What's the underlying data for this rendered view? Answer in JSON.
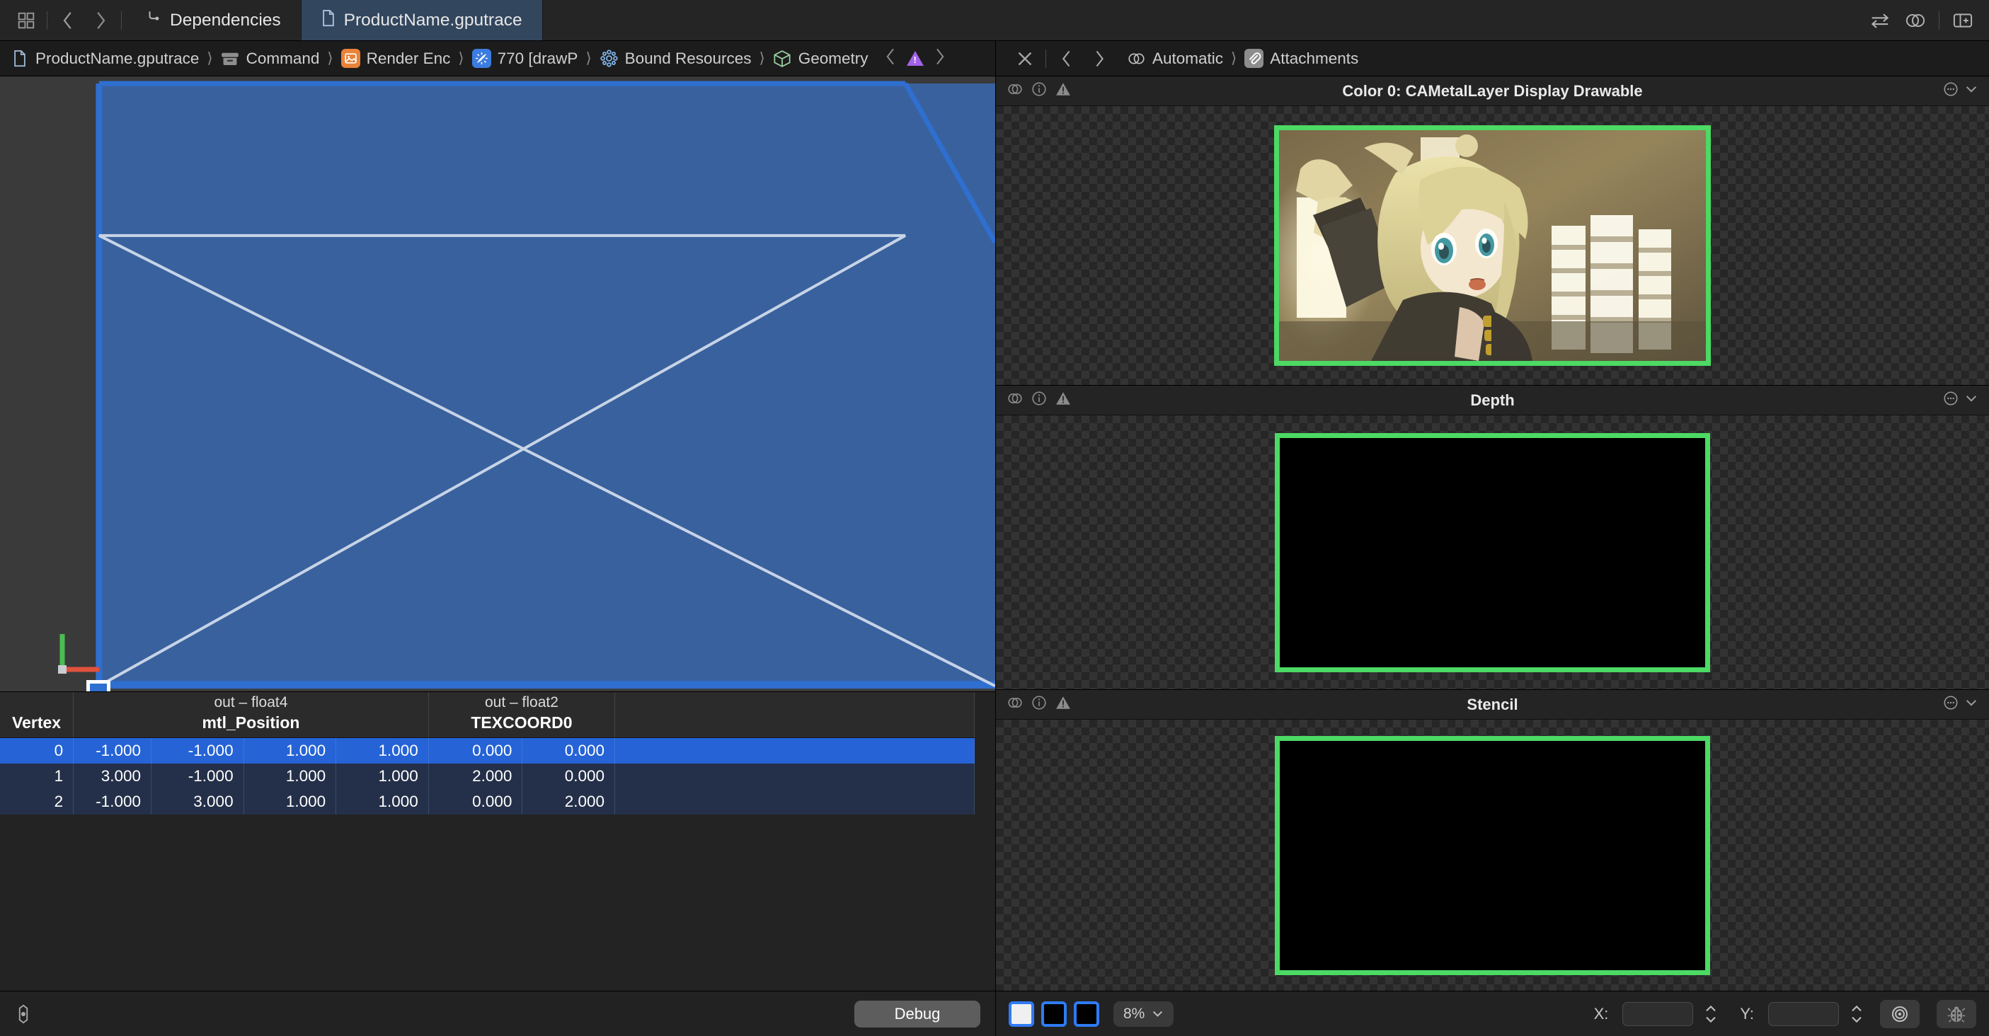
{
  "window": {
    "tabs": [
      {
        "label": "Dependencies",
        "icon": "dependencies-icon",
        "active": false
      },
      {
        "label": "ProductName.gputrace",
        "icon": "document-icon",
        "active": true
      }
    ],
    "toolbar_icons": [
      "grid-icon",
      "back-chevron-icon",
      "forward-chevron-icon"
    ],
    "right_icons": [
      "swap-arrows-icon",
      "overlap-circles-icon",
      "inspector-panel-icon"
    ]
  },
  "breadcrumb": {
    "items": [
      {
        "label": "ProductName.gputrace",
        "icon": "document-icon"
      },
      {
        "label": "Command",
        "icon": "archive-box-icon"
      },
      {
        "label": "Render Enc",
        "icon": "render-encoder-icon"
      },
      {
        "label": "770 [drawP",
        "icon": "draw-call-icon"
      },
      {
        "label": "Bound Resources",
        "icon": "resources-icon"
      },
      {
        "label": "Geometry",
        "icon": "geometry-cube-icon"
      }
    ],
    "separator": "⟩",
    "warning_icon": "warning-triangle-icon"
  },
  "attachments_bar": {
    "close_icon": "close-icon",
    "back_icon": "back-chevron-icon",
    "forward_icon": "forward-chevron-icon",
    "mode_label": "Automatic",
    "mode_icon": "overlap-circles-icon",
    "section_label": "Attachments",
    "section_icon": "paperclip-icon",
    "separator": "⟩"
  },
  "geometry": {
    "axis_x_color": "#e0523c",
    "axis_y_color": "#4cbb52",
    "triangle_fill": "#39619e",
    "triangle_edge": "#2f6fd0",
    "wire_color": "#c7d4e6",
    "background": "#3a3a3a",
    "selected_vertex_marker": "vertex-0"
  },
  "vertex_table": {
    "columns": [
      {
        "name": "Vertex",
        "qualifier": "",
        "span": 1
      },
      {
        "name": "mtl_Position",
        "qualifier": "out – float4",
        "span": 4
      },
      {
        "name": "TEXCOORD0",
        "qualifier": "out – float2",
        "span": 2
      }
    ],
    "rows": [
      {
        "vertex": "0",
        "position": [
          "-1.000",
          "-1.000",
          "1.000",
          "1.000"
        ],
        "texcoord": [
          "0.000",
          "0.000"
        ],
        "selected": true
      },
      {
        "vertex": "1",
        "position": [
          "3.000",
          "-1.000",
          "1.000",
          "1.000"
        ],
        "texcoord": [
          "2.000",
          "0.000"
        ],
        "selected": false
      },
      {
        "vertex": "2",
        "position": [
          "-1.000",
          "3.000",
          "1.000",
          "1.000"
        ],
        "texcoord": [
          "0.000",
          "2.000"
        ],
        "selected": false
      }
    ],
    "selected_row_color": "#2563d6",
    "row_color": "#243049"
  },
  "left_bottom_bar": {
    "settings_icon": "gear-icon",
    "debug_label": "Debug"
  },
  "attachment_panels": [
    {
      "title": "Color 0: CAMetalLayer Display Drawable",
      "icons": [
        "overlap-circles-icon",
        "info-icon",
        "warning-triangle-icon"
      ],
      "menu_icon": "more-options-icon",
      "chevron_icon": "chevron-down-icon",
      "content": "image",
      "border_color": "#4cd964"
    },
    {
      "title": "Depth",
      "icons": [
        "overlap-circles-icon",
        "info-icon",
        "warning-triangle-icon"
      ],
      "menu_icon": "more-options-icon",
      "chevron_icon": "chevron-down-icon",
      "content": "black",
      "border_color": "#4cd964"
    },
    {
      "title": "Stencil",
      "icons": [
        "overlap-circles-icon",
        "info-icon",
        "warning-triangle-icon"
      ],
      "menu_icon": "more-options-icon",
      "chevron_icon": "chevron-down-icon",
      "content": "black",
      "border_color": "#4cd964"
    }
  ],
  "right_bottom_bar": {
    "channel_swatches": [
      "white",
      "black",
      "black"
    ],
    "zoom_value": "8%",
    "zoom_chevron": "chevron-down-icon",
    "x_label": "X:",
    "x_value": "",
    "y_label": "Y:",
    "y_value": "",
    "target_icon": "target-icon",
    "bug_icon": "ladybug-icon"
  }
}
